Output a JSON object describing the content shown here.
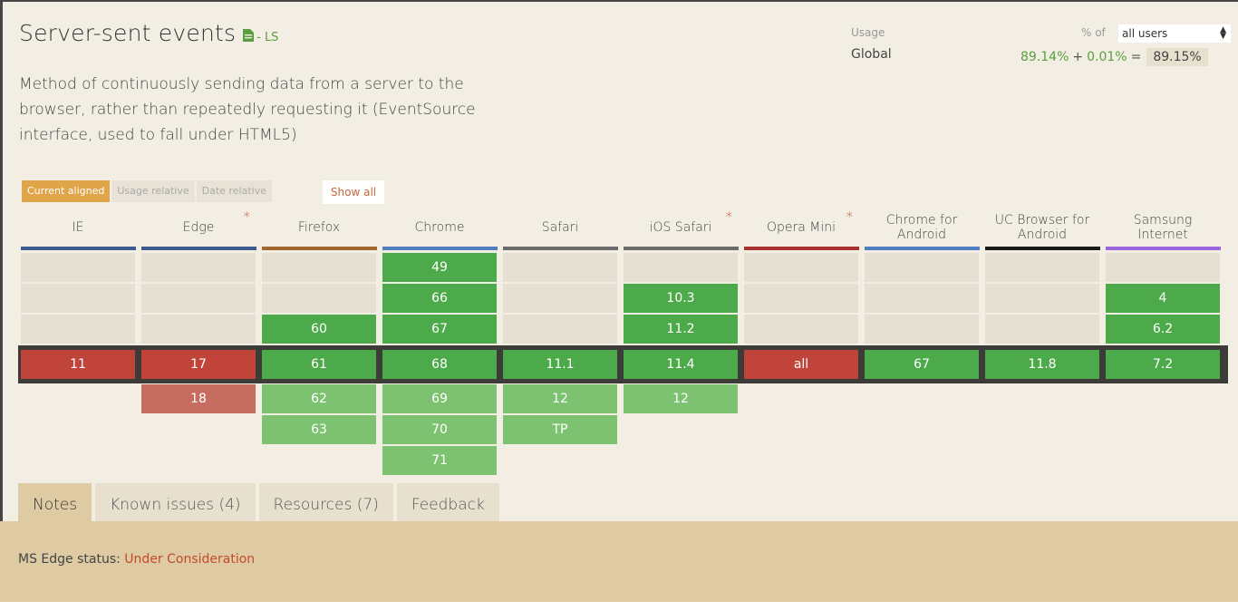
{
  "feature": {
    "title": "Server-sent events",
    "status_dash": "-",
    "status_abbr": "LS",
    "description": "Method of continuously sending data from a server to the browser, rather than repeatedly requesting it (EventSource interface, used to fall under HTML5)",
    "doc_icon": "document-icon"
  },
  "usage": {
    "label": "Usage",
    "region": "Global",
    "pct_of": "% of",
    "users_option": "all users",
    "full": "89.14%",
    "plus": "+",
    "partial": "0.01%",
    "equals": "=",
    "total": "89.15%"
  },
  "mode_buttons": [
    "Current aligned",
    "Usage relative",
    "Date relative"
  ],
  "show_all": "Show all",
  "browsers": [
    {
      "name": "IE",
      "star": false,
      "color": "#3e5b8f"
    },
    {
      "name": "Edge",
      "star": true,
      "color": "#3e5b8f"
    },
    {
      "name": "Firefox",
      "star": false,
      "color": "#a0662e"
    },
    {
      "name": "Chrome",
      "star": false,
      "color": "#4f7fc0"
    },
    {
      "name": "Safari",
      "star": false,
      "color": "#6b6b6b"
    },
    {
      "name": "iOS Safari",
      "star": true,
      "color": "#6b6b6b"
    },
    {
      "name": "Opera Mini",
      "star": true,
      "color": "#a8322f"
    },
    {
      "name": "Chrome for Android",
      "star": false,
      "color": "#4f7fc0"
    },
    {
      "name": "UC Browser for Android",
      "star": false,
      "color": "#1a1a1a"
    },
    {
      "name": "Samsung Internet",
      "star": false,
      "color": "#9a66e0"
    }
  ],
  "star_symbol": "*",
  "support": [
    {
      "past": [
        {
          "v": "",
          "s": "blank"
        },
        {
          "v": "",
          "s": "blank"
        },
        {
          "v": "",
          "s": "blank"
        }
      ],
      "current": {
        "v": "11",
        "s": "n"
      },
      "future": []
    },
    {
      "past": [
        {
          "v": "",
          "s": "blank"
        },
        {
          "v": "",
          "s": "blank"
        },
        {
          "v": "",
          "s": "blank"
        }
      ],
      "current": {
        "v": "17",
        "s": "n"
      },
      "future": [
        {
          "v": "18",
          "s": "nl"
        }
      ]
    },
    {
      "past": [
        {
          "v": "",
          "s": "blank"
        },
        {
          "v": "",
          "s": "blank"
        },
        {
          "v": "60",
          "s": "y"
        }
      ],
      "current": {
        "v": "61",
        "s": "y"
      },
      "future": [
        {
          "v": "62",
          "s": "yl"
        },
        {
          "v": "63",
          "s": "yl"
        }
      ]
    },
    {
      "past": [
        {
          "v": "49",
          "s": "y"
        },
        {
          "v": "66",
          "s": "y"
        },
        {
          "v": "67",
          "s": "y"
        }
      ],
      "current": {
        "v": "68",
        "s": "y"
      },
      "future": [
        {
          "v": "69",
          "s": "yl"
        },
        {
          "v": "70",
          "s": "yl"
        },
        {
          "v": "71",
          "s": "yl"
        }
      ]
    },
    {
      "past": [
        {
          "v": "",
          "s": "blank"
        },
        {
          "v": "",
          "s": "blank"
        },
        {
          "v": "",
          "s": "blank"
        }
      ],
      "current": {
        "v": "11.1",
        "s": "y"
      },
      "future": [
        {
          "v": "12",
          "s": "yl"
        },
        {
          "v": "TP",
          "s": "yl"
        }
      ]
    },
    {
      "past": [
        {
          "v": "",
          "s": "blank"
        },
        {
          "v": "10.3",
          "s": "y"
        },
        {
          "v": "11.2",
          "s": "y"
        }
      ],
      "current": {
        "v": "11.4",
        "s": "y"
      },
      "future": [
        {
          "v": "12",
          "s": "yl"
        }
      ]
    },
    {
      "past": [
        {
          "v": "",
          "s": "blank"
        },
        {
          "v": "",
          "s": "blank"
        },
        {
          "v": "",
          "s": "blank"
        }
      ],
      "current": {
        "v": "all",
        "s": "n"
      },
      "future": []
    },
    {
      "past": [
        {
          "v": "",
          "s": "blank"
        },
        {
          "v": "",
          "s": "blank"
        },
        {
          "v": "",
          "s": "blank"
        }
      ],
      "current": {
        "v": "67",
        "s": "y"
      },
      "future": []
    },
    {
      "past": [
        {
          "v": "",
          "s": "blank"
        },
        {
          "v": "",
          "s": "blank"
        },
        {
          "v": "",
          "s": "blank"
        }
      ],
      "current": {
        "v": "11.8",
        "s": "y"
      },
      "future": []
    },
    {
      "past": [
        {
          "v": "",
          "s": "blank"
        },
        {
          "v": "4",
          "s": "y"
        },
        {
          "v": "6.2",
          "s": "y"
        }
      ],
      "current": {
        "v": "7.2",
        "s": "y"
      },
      "future": []
    }
  ],
  "tabs": [
    "Notes",
    "Known issues (4)",
    "Resources (7)",
    "Feedback"
  ],
  "notes": {
    "edge_status_label": "MS Edge status:",
    "edge_status_value": "Under Consideration"
  }
}
